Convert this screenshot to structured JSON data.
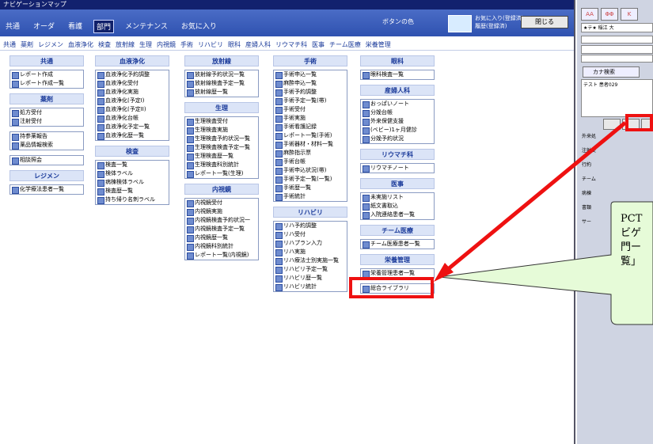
{
  "title": "ナビゲーションマップ",
  "menu": [
    "共通",
    "オーダ",
    "看護",
    "部門",
    "メンテナンス",
    "お気に入り"
  ],
  "active_menu": "部門",
  "color_label": "ボタンの色",
  "fav_line1": "お気に入り(登録済)",
  "fav_line2": "履歴(登録済)",
  "close_label": "閉じる",
  "subnav": [
    "共通",
    "薬剤",
    "レジメン",
    "血液浄化",
    "検査",
    "放射線",
    "生理",
    "内視鏡",
    "手術",
    "リハビリ",
    "眼科",
    "産婦人科",
    "リウマチ科",
    "医事",
    "チーム医療",
    "栄養管理"
  ],
  "columns": [
    {
      "sections": [
        {
          "title": "共通",
          "items": [
            "レポート作成",
            "レポート作成一覧"
          ]
        },
        {
          "title": "薬剤",
          "items": [
            "処方受付",
            "注射受付"
          ]
        },
        {
          "title": "",
          "items": [
            "持参薬報告",
            "薬品情報検索"
          ]
        },
        {
          "title": "",
          "items": [
            "相談照会"
          ]
        },
        {
          "title": "レジメン",
          "items": [
            "化学療法患者一覧"
          ]
        }
      ]
    },
    {
      "sections": [
        {
          "title": "血液浄化",
          "items": [
            "血液浄化予約調整",
            "血液浄化受付",
            "血液浄化実施",
            "血液浄化(予定I)",
            "血液浄化(予定II)",
            "血液浄化台帳",
            "血液浄化予定一覧",
            "血液浄化歴一覧"
          ]
        },
        {
          "title": "検査",
          "items": [
            "検査一覧",
            "検体ラベル",
            "病棟検体ラベル",
            "検査歴一覧",
            "持ち帰り名刺ラベル"
          ]
        }
      ]
    },
    {
      "sections": [
        {
          "title": "放射線",
          "items": [
            "放射線予約状況一覧",
            "放射線検査予定一覧",
            "放射線歴一覧"
          ]
        },
        {
          "title": "生理",
          "items": [
            "生理検査受付",
            "生理検査実施",
            "生理検査予約状況一覧",
            "生理検査検査予定一覧",
            "生理検査歴一覧",
            "生理検査科別統計",
            "レポート一覧(生理)"
          ]
        },
        {
          "title": "内視鏡",
          "items": [
            "内視鏡受付",
            "内視鏡実施",
            "内視鏡検査予約状況一",
            "内視鏡検査予定一覧",
            "内視鏡歴一覧",
            "内視鏡科別統計",
            "レポート一覧(内視鏡)"
          ]
        }
      ]
    },
    {
      "sections": [
        {
          "title": "手術",
          "items": [
            "手術申込一覧",
            "麻酔申込一覧",
            "手術予約調整",
            "手術予定一覧(帯)",
            "手術受付",
            "手術実施",
            "手術看護記録",
            "レポート一覧(手術)",
            "手術器材・材料一覧",
            "麻酔指示票",
            "手術台帳",
            "手術申込状況(帯)",
            "手術予定一覧(一覧)",
            "手術歴一覧",
            "手術統計"
          ]
        },
        {
          "title": "リハビリ",
          "items": [
            "リハ予約調整",
            "リハ受付",
            "リハプラン入力",
            "リハ実施",
            "リハ療法士別実施一覧",
            "リハビリ予定一覧",
            "リハビリ歴一覧",
            "リハビリ統計"
          ]
        }
      ]
    },
    {
      "sections": [
        {
          "title": "眼科",
          "items": [
            "眼科検査一覧"
          ]
        },
        {
          "title": "産婦人科",
          "items": [
            "おっぱいノート",
            "分娩台帳",
            "外来保健支援",
            "(ベビー)1ヶ月健診",
            "分娩予約状況"
          ]
        },
        {
          "title": "リウマチ科",
          "items": [
            "リウマチノート"
          ]
        },
        {
          "title": "医事",
          "items": [
            "未実施リスト",
            "紙文書取込",
            "入院連絡患者一覧"
          ]
        },
        {
          "title": "チーム医療",
          "items": [
            "チーム医療患者一覧"
          ]
        },
        {
          "title": "栄養管理",
          "items": [
            "栄養管理患者一覧"
          ]
        },
        {
          "title": "",
          "items": [
            "総合ライブラリ"
          ]
        }
      ]
    }
  ],
  "right": {
    "buttons": [
      "AA",
      "ΦΦ",
      "K"
    ],
    "user": "★テ★ 稲江 大",
    "kana": "カナ検索",
    "list_first": "テスト 患者029",
    "icons": [
      "外来処",
      "注射受",
      "行約",
      "チーム",
      "病棟",
      "書類",
      "サー"
    ]
  },
  "callout_lines": [
    "PCT",
    "ビゲ",
    "門ー",
    "覧」"
  ]
}
